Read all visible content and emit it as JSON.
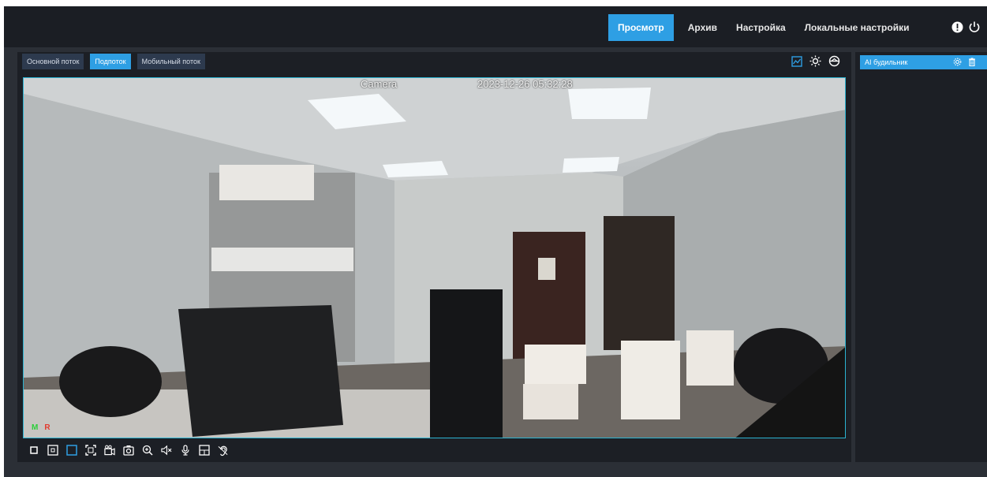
{
  "header": {
    "tabs": [
      {
        "label": "Просмотр",
        "active": true
      },
      {
        "label": "Архив",
        "active": false
      },
      {
        "label": "Настройка",
        "active": false
      },
      {
        "label": "Локальные настройки",
        "active": false
      }
    ],
    "icons": [
      "alert-icon",
      "power-icon"
    ]
  },
  "streams": [
    {
      "label": "Основной поток",
      "active": false
    },
    {
      "label": "Подпоток",
      "active": true
    },
    {
      "label": "Мобильный поток",
      "active": false
    }
  ],
  "view_tools": [
    "image-analysis-icon",
    "brightness-icon",
    "ptz-icon"
  ],
  "video": {
    "osd_name": "Camera",
    "osd_time": "2023-12-26 05:32:28",
    "markers": {
      "m": "M",
      "r": "R"
    }
  },
  "controls": [
    "stop-icon",
    "window-icon",
    "fit-window-icon",
    "fullscreen-icon",
    "record-icon",
    "snapshot-icon",
    "zoom-icon",
    "mute-icon",
    "microphone-icon",
    "region-icon",
    "ear-icon"
  ],
  "right_panel": {
    "item_label": "AI будильник",
    "item_icons": [
      "settings-icon",
      "delete-icon"
    ]
  },
  "colors": {
    "accent": "#2e9fe4",
    "topbar": "#1b1e24",
    "panel": "#1c1f25",
    "border": "#2bb3d1"
  }
}
